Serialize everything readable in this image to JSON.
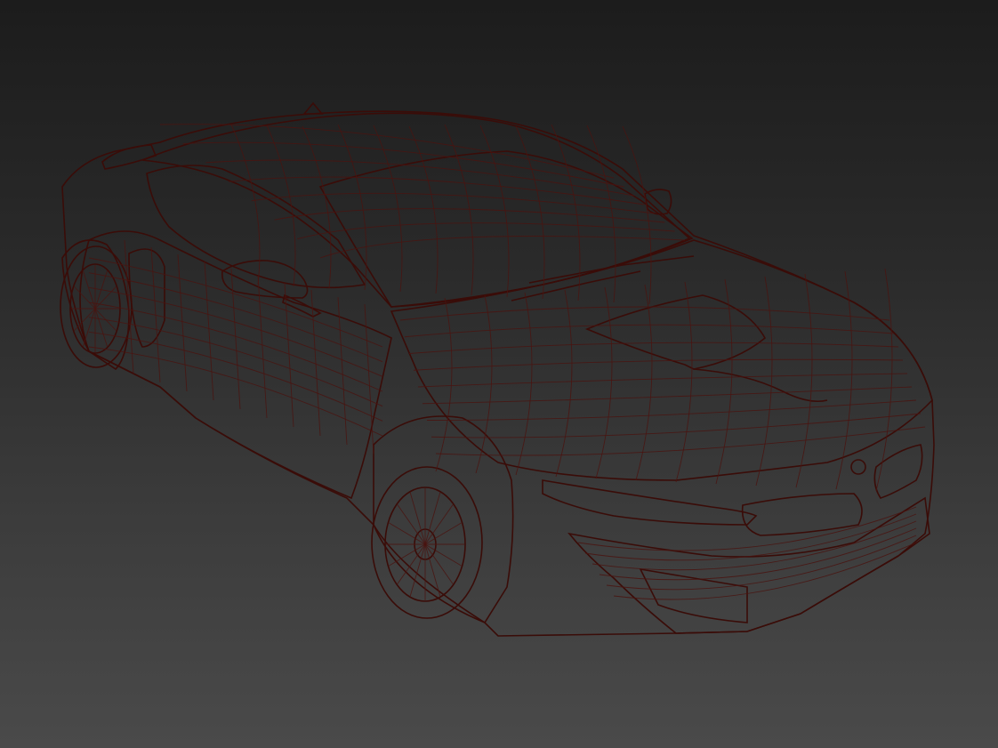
{
  "viewport": {
    "background_top": "#1c1c1c",
    "background_bottom": "#4a4a4a",
    "render_mode": "wireframe-on-shaded"
  },
  "model": {
    "material_color": "#c24a3f",
    "wire_color": "#4a1410",
    "shadow_color": "#7a2a22",
    "highlight_color": "#d8675b",
    "icon": "sports-car-model"
  }
}
